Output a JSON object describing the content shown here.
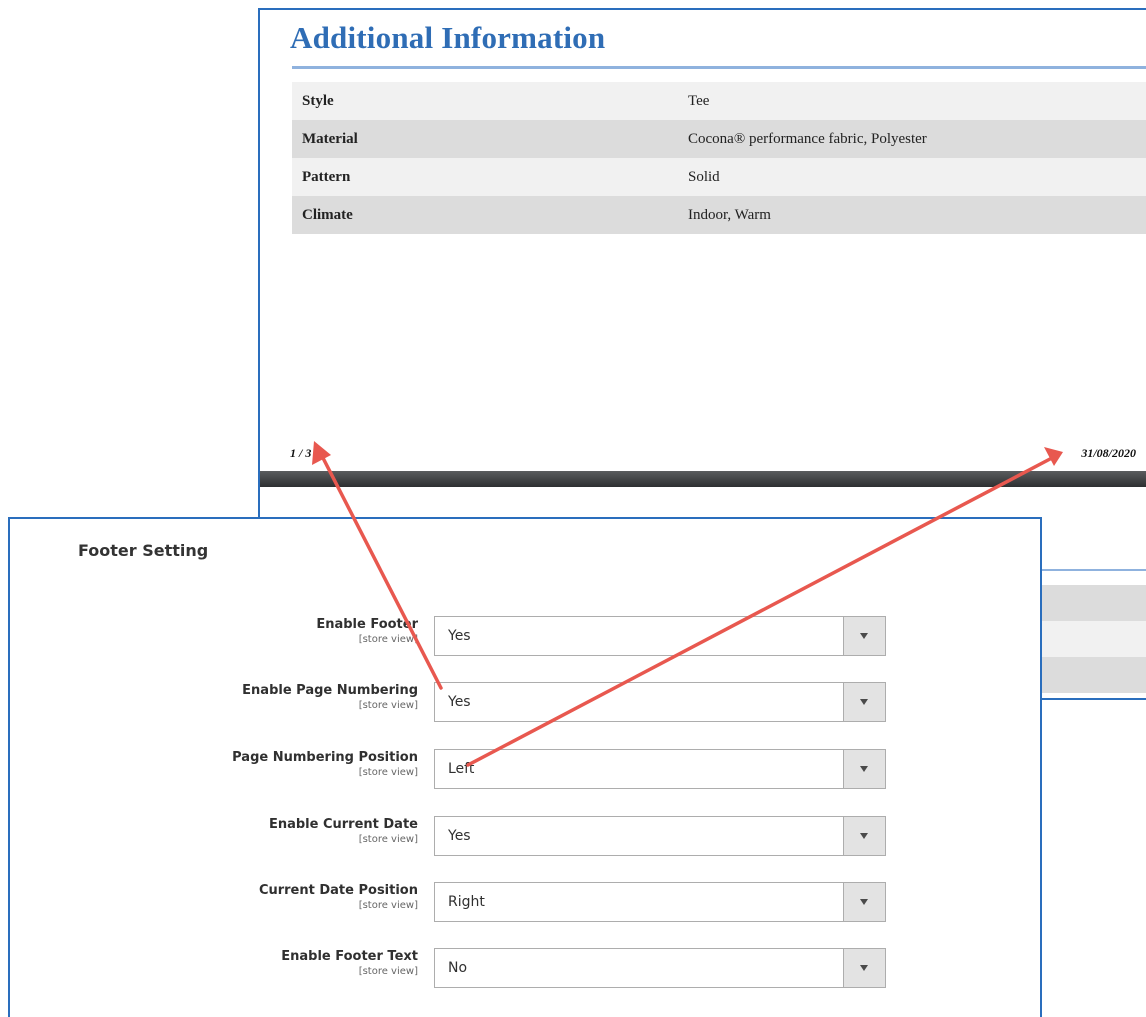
{
  "pdf_preview": {
    "title": "Additional Information",
    "attributes": [
      {
        "label": "Style",
        "value": "Tee"
      },
      {
        "label": "Material",
        "value": "Cocona® performance fabric, Polyester"
      },
      {
        "label": "Pattern",
        "value": "Solid"
      },
      {
        "label": "Climate",
        "value": "Indoor, Warm"
      }
    ],
    "page_number": "1 / 3",
    "current_date": "31/08/2020"
  },
  "footer_setting": {
    "title": "Footer Setting",
    "scope_label": "[store view]",
    "fields": [
      {
        "label": "Enable Footer",
        "value": "Yes"
      },
      {
        "label": "Enable Page Numbering",
        "value": "Yes"
      },
      {
        "label": "Page Numbering Position",
        "value": "Left"
      },
      {
        "label": "Enable Current Date",
        "value": "Yes"
      },
      {
        "label": "Current Date Position",
        "value": "Right"
      },
      {
        "label": "Enable Footer Text",
        "value": "No"
      }
    ]
  },
  "colors": {
    "accent_blue": "#2a6ebd",
    "title_blue": "#2f6db5",
    "annotation_arrow": "#e8584f"
  },
  "icons": {
    "select_arrow": "chevron-down-icon"
  }
}
